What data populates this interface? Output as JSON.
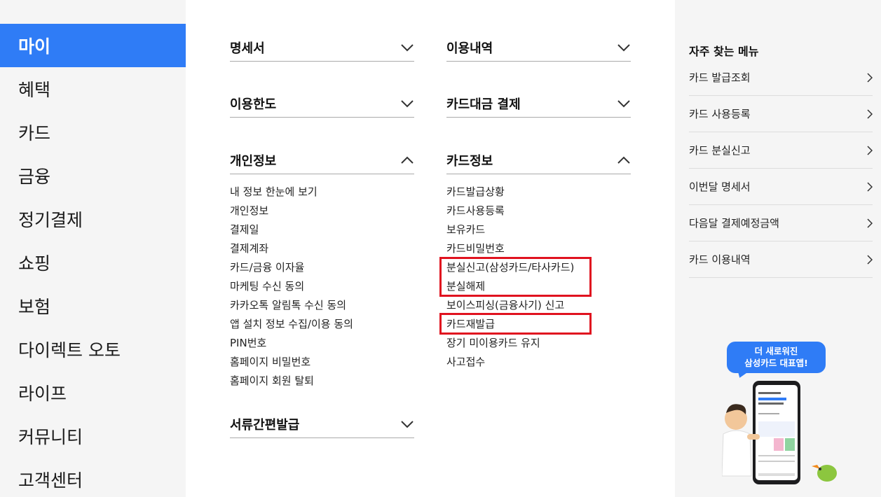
{
  "left_nav": {
    "items": [
      "마이",
      "혜택",
      "카드",
      "금융",
      "정기결제",
      "쇼핑",
      "보험",
      "다이렉트 오토",
      "라이프",
      "커뮤니티",
      "고객센터"
    ],
    "active_index": 0
  },
  "menu": {
    "statement": "명세서",
    "usage_history": "이용내역",
    "limit": "이용한도",
    "card_payment": "카드대금 결제",
    "personal_info": {
      "title": "개인정보",
      "items": [
        "내 정보 한눈에 보기",
        "개인정보",
        "결제일",
        "결제계좌",
        "카드/금융 이자율",
        "마케팅 수신 동의",
        "카카오톡 알림톡 수신 동의",
        "앱 설치 정보 수집/이용 동의",
        "PIN번호",
        "홈페이지 비밀번호",
        "홈페이지 회원 탈퇴"
      ]
    },
    "card_info": {
      "title": "카드정보",
      "items": [
        "카드발급상황",
        "카드사용등록",
        "보유카드",
        "카드비밀번호",
        "분실신고(삼성카드/타사카드)",
        "분실해제",
        "보이스피싱(금융사기) 신고",
        "카드재발급",
        "장기 미이용카드 유지",
        "사고접수"
      ]
    },
    "documents": "서류간편발급"
  },
  "quick_menu": {
    "title": "자주 찾는 메뉴",
    "items": [
      "카드 발급조회",
      "카드 사용등록",
      "카드 분실신고",
      "이번달 명세서",
      "다음달 결제예정금액",
      "카드 이용내역"
    ]
  },
  "promo": {
    "line1": "더 새로워진",
    "line2": "삼성카드 대표앱!"
  },
  "colors": {
    "accent": "#2f7cf6",
    "highlight": "#e0121f",
    "panel_bg": "#f5f5f5"
  }
}
